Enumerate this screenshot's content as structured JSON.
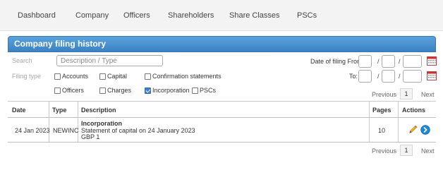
{
  "nav": {
    "dashboard": "Dashboard",
    "company": "Company",
    "officers": "Officers",
    "shareholders": "Shareholders",
    "share_classes": "Share Classes",
    "pscs": "PSCs"
  },
  "panel": {
    "title": "Company filing history",
    "accent": "#4a90d0"
  },
  "filters": {
    "search_label": "Search",
    "search_placeholder": "Description / Type",
    "search_value": "",
    "filing_type_label": "Filing type",
    "types": [
      {
        "label": "Accounts",
        "checked": false
      },
      {
        "label": "Capital",
        "checked": false
      },
      {
        "label": "Confirmation statements",
        "checked": false
      },
      {
        "label": "Officers",
        "checked": false
      },
      {
        "label": "Charges",
        "checked": false
      },
      {
        "label": "Incorporation",
        "checked": true
      },
      {
        "label": "PSCs",
        "checked": false
      }
    ],
    "date_from_label": "Date of filing From:",
    "date_to_label": "To:",
    "date_separator": "/"
  },
  "pagination": {
    "previous": "Previous",
    "page": "1",
    "next": "Next"
  },
  "table": {
    "headers": {
      "date": "Date",
      "type": "Type",
      "description": "Description",
      "pages": "Pages",
      "actions": "Actions"
    },
    "rows": [
      {
        "date": "24 Jan 2023",
        "type": "NEWINC",
        "desc_title": "Incorporation",
        "desc_line1": "Statement of capital on 24 January 2023",
        "desc_line2": "GBP 1",
        "pages": "10",
        "actions": [
          "pencil-icon",
          "chevron-right-icon"
        ]
      }
    ]
  }
}
